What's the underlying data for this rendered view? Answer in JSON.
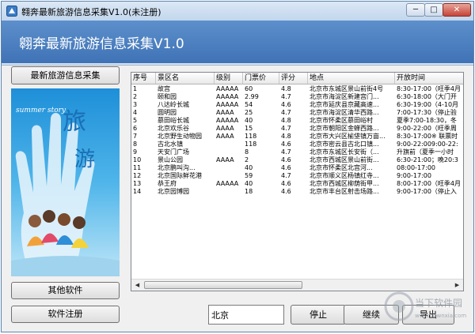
{
  "window": {
    "title": "翱奔最新旅游信息采集V1.0(未注册)",
    "controls": {
      "minimize": "─",
      "maximize": "□",
      "close": "✕"
    }
  },
  "header": {
    "title": "翱奔最新旅游信息采集V1.0"
  },
  "sidebar": {
    "collect_button": "最新旅游信息采集",
    "banner": {
      "caption": "summer  story",
      "big_chars": [
        "旅",
        "游"
      ]
    },
    "other_software_button": "其他软件",
    "register_button": "软件注册"
  },
  "table": {
    "columns": [
      "序号",
      "景区名",
      "级别",
      "门票价",
      "评分",
      "地点",
      "开放时间"
    ],
    "rows": [
      [
        "1",
        "故宫",
        "AAAAA",
        "60",
        "4.8",
        "北京市东城区景山前街4号",
        "8:30-17:00（旺季4月"
      ],
      [
        "2",
        "颐和园",
        "AAAAA",
        "2.99",
        "4.7",
        "北京市海淀区新建宫门...",
        "6:30-18:00（大门开"
      ],
      [
        "3",
        "八达岭长城",
        "AAAAA",
        "54",
        "4.6",
        "北京市延庆县京藏高速...",
        "6:30-19:00（4-10月"
      ],
      [
        "4",
        "圆明园",
        "AAAA",
        "25",
        "4.7",
        "北京市海淀区清华西路...",
        "7:00-17:30（停止验"
      ],
      [
        "5",
        "慕田峪长城",
        "AAAAA",
        "40",
        "4.8",
        "北京市怀柔区慕田峪村",
        "夏季7:00-18:30，冬"
      ],
      [
        "6",
        "北京欢乐谷",
        "AAAA",
        "15",
        "4.7",
        "北京市朝阳区金蝉西路...",
        "9:00-22:00（旺季周"
      ],
      [
        "7",
        "北京野生动物园",
        "AAAA",
        "118",
        "4.8",
        "北京市大兴区榆垡镇万亩...",
        "8:30-17:00※ 联票时"
      ],
      [
        "8",
        "古北水镇",
        "",
        "118",
        "4.6",
        "北京市密云县古北口镇...",
        "9:00-22:009:00-22:"
      ],
      [
        "9",
        "天安门广场",
        "",
        "8",
        "4.7",
        "北京市东城区长安街（...",
        "升旗前（夏季一小时"
      ],
      [
        "10",
        "景山公园",
        "AAAA",
        "2",
        "4.6",
        "北京市西城区景山前街...",
        "6:30-21:00；晚20:3"
      ],
      [
        "11",
        "北京鹏叫沟...",
        "",
        "40",
        "4.6",
        "北京市怀柔区北宫河...",
        "08:00-17:00"
      ],
      [
        "12",
        "北京国际鲜花港",
        "",
        "59",
        "4.7",
        "北京市顺义区杨镇红寺...",
        "9:00-17:00"
      ],
      [
        "13",
        "恭王府",
        "AAAAA",
        "40",
        "4.6",
        "北京市西城区柳荫街甲...",
        "8:00-17:00（旺季4月"
      ],
      [
        "14",
        "北京园博园",
        "",
        "18",
        "4.6",
        "北京市丰台区射击场路...",
        "9:00-17:00（停止入"
      ]
    ]
  },
  "controls": {
    "city_value": "北京",
    "stop_button": "停止",
    "continue_button": "继续",
    "export_button": "导出"
  },
  "watermark": {
    "text": "当下软件园",
    "url": "www.downxia.com"
  }
}
